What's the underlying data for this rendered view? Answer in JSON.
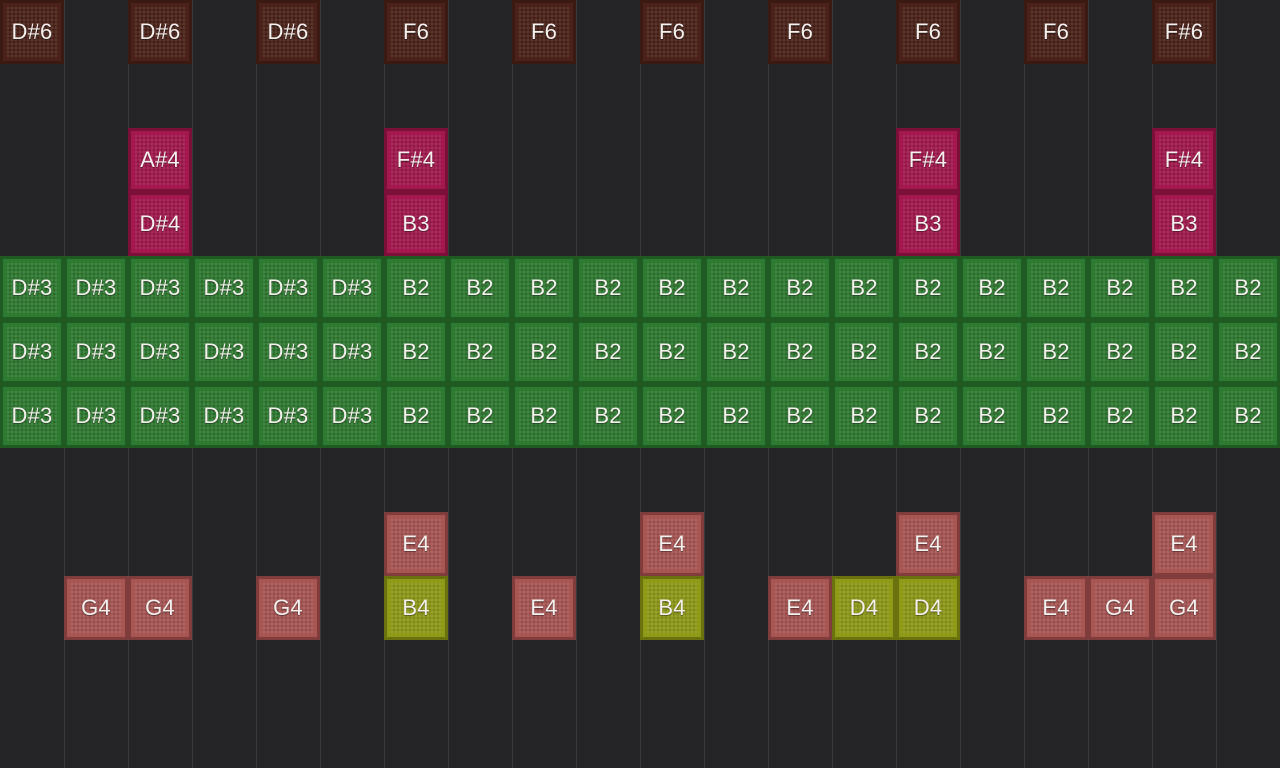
{
  "grid": {
    "columns": 20,
    "rows": 12,
    "background": "#252527",
    "column_line_color": "#39393c"
  },
  "palette": {
    "high": {
      "bg": "#4a2219",
      "border": "#3a1912"
    },
    "magenta": {
      "bg": "#a3184e",
      "border": "#7a0f37"
    },
    "bass": {
      "bg": "#2f7a31",
      "border": "#1f5a22"
    },
    "salmon": {
      "bg": "#a85654",
      "border": "#7e3c3b"
    },
    "olive": {
      "bg": "#8f9a18",
      "border": "#6a720f"
    }
  },
  "notes": [
    {
      "col": 0,
      "row": 0,
      "label": "D#6",
      "color": "high"
    },
    {
      "col": 2,
      "row": 0,
      "label": "D#6",
      "color": "high"
    },
    {
      "col": 4,
      "row": 0,
      "label": "D#6",
      "color": "high"
    },
    {
      "col": 6,
      "row": 0,
      "label": "F6",
      "color": "high"
    },
    {
      "col": 8,
      "row": 0,
      "label": "F6",
      "color": "high"
    },
    {
      "col": 10,
      "row": 0,
      "label": "F6",
      "color": "high"
    },
    {
      "col": 12,
      "row": 0,
      "label": "F6",
      "color": "high"
    },
    {
      "col": 14,
      "row": 0,
      "label": "F6",
      "color": "high"
    },
    {
      "col": 16,
      "row": 0,
      "label": "F6",
      "color": "high"
    },
    {
      "col": 18,
      "row": 0,
      "label": "F#6",
      "color": "high"
    },
    {
      "col": 2,
      "row": 2,
      "label": "A#4",
      "color": "magenta"
    },
    {
      "col": 6,
      "row": 2,
      "label": "F#4",
      "color": "magenta"
    },
    {
      "col": 14,
      "row": 2,
      "label": "F#4",
      "color": "magenta"
    },
    {
      "col": 18,
      "row": 2,
      "label": "F#4",
      "color": "magenta"
    },
    {
      "col": 2,
      "row": 3,
      "label": "D#4",
      "color": "magenta"
    },
    {
      "col": 6,
      "row": 3,
      "label": "B3",
      "color": "magenta"
    },
    {
      "col": 14,
      "row": 3,
      "label": "B3",
      "color": "magenta"
    },
    {
      "col": 18,
      "row": 3,
      "label": "B3",
      "color": "magenta"
    },
    {
      "col": 0,
      "row": 4,
      "label": "D#3",
      "color": "bass"
    },
    {
      "col": 1,
      "row": 4,
      "label": "D#3",
      "color": "bass"
    },
    {
      "col": 2,
      "row": 4,
      "label": "D#3",
      "color": "bass"
    },
    {
      "col": 3,
      "row": 4,
      "label": "D#3",
      "color": "bass"
    },
    {
      "col": 4,
      "row": 4,
      "label": "D#3",
      "color": "bass"
    },
    {
      "col": 5,
      "row": 4,
      "label": "D#3",
      "color": "bass"
    },
    {
      "col": 6,
      "row": 4,
      "label": "B2",
      "color": "bass"
    },
    {
      "col": 7,
      "row": 4,
      "label": "B2",
      "color": "bass"
    },
    {
      "col": 8,
      "row": 4,
      "label": "B2",
      "color": "bass"
    },
    {
      "col": 9,
      "row": 4,
      "label": "B2",
      "color": "bass"
    },
    {
      "col": 10,
      "row": 4,
      "label": "B2",
      "color": "bass"
    },
    {
      "col": 11,
      "row": 4,
      "label": "B2",
      "color": "bass"
    },
    {
      "col": 12,
      "row": 4,
      "label": "B2",
      "color": "bass"
    },
    {
      "col": 13,
      "row": 4,
      "label": "B2",
      "color": "bass"
    },
    {
      "col": 14,
      "row": 4,
      "label": "B2",
      "color": "bass"
    },
    {
      "col": 15,
      "row": 4,
      "label": "B2",
      "color": "bass"
    },
    {
      "col": 16,
      "row": 4,
      "label": "B2",
      "color": "bass"
    },
    {
      "col": 17,
      "row": 4,
      "label": "B2",
      "color": "bass"
    },
    {
      "col": 18,
      "row": 4,
      "label": "B2",
      "color": "bass"
    },
    {
      "col": 19,
      "row": 4,
      "label": "B2",
      "color": "bass"
    },
    {
      "col": 0,
      "row": 5,
      "label": "D#3",
      "color": "bass"
    },
    {
      "col": 1,
      "row": 5,
      "label": "D#3",
      "color": "bass"
    },
    {
      "col": 2,
      "row": 5,
      "label": "D#3",
      "color": "bass"
    },
    {
      "col": 3,
      "row": 5,
      "label": "D#3",
      "color": "bass"
    },
    {
      "col": 4,
      "row": 5,
      "label": "D#3",
      "color": "bass"
    },
    {
      "col": 5,
      "row": 5,
      "label": "D#3",
      "color": "bass"
    },
    {
      "col": 6,
      "row": 5,
      "label": "B2",
      "color": "bass"
    },
    {
      "col": 7,
      "row": 5,
      "label": "B2",
      "color": "bass"
    },
    {
      "col": 8,
      "row": 5,
      "label": "B2",
      "color": "bass"
    },
    {
      "col": 9,
      "row": 5,
      "label": "B2",
      "color": "bass"
    },
    {
      "col": 10,
      "row": 5,
      "label": "B2",
      "color": "bass"
    },
    {
      "col": 11,
      "row": 5,
      "label": "B2",
      "color": "bass"
    },
    {
      "col": 12,
      "row": 5,
      "label": "B2",
      "color": "bass"
    },
    {
      "col": 13,
      "row": 5,
      "label": "B2",
      "color": "bass"
    },
    {
      "col": 14,
      "row": 5,
      "label": "B2",
      "color": "bass"
    },
    {
      "col": 15,
      "row": 5,
      "label": "B2",
      "color": "bass"
    },
    {
      "col": 16,
      "row": 5,
      "label": "B2",
      "color": "bass"
    },
    {
      "col": 17,
      "row": 5,
      "label": "B2",
      "color": "bass"
    },
    {
      "col": 18,
      "row": 5,
      "label": "B2",
      "color": "bass"
    },
    {
      "col": 19,
      "row": 5,
      "label": "B2",
      "color": "bass"
    },
    {
      "col": 0,
      "row": 6,
      "label": "D#3",
      "color": "bass"
    },
    {
      "col": 1,
      "row": 6,
      "label": "D#3",
      "color": "bass"
    },
    {
      "col": 2,
      "row": 6,
      "label": "D#3",
      "color": "bass"
    },
    {
      "col": 3,
      "row": 6,
      "label": "D#3",
      "color": "bass"
    },
    {
      "col": 4,
      "row": 6,
      "label": "D#3",
      "color": "bass"
    },
    {
      "col": 5,
      "row": 6,
      "label": "D#3",
      "color": "bass"
    },
    {
      "col": 6,
      "row": 6,
      "label": "B2",
      "color": "bass"
    },
    {
      "col": 7,
      "row": 6,
      "label": "B2",
      "color": "bass"
    },
    {
      "col": 8,
      "row": 6,
      "label": "B2",
      "color": "bass"
    },
    {
      "col": 9,
      "row": 6,
      "label": "B2",
      "color": "bass"
    },
    {
      "col": 10,
      "row": 6,
      "label": "B2",
      "color": "bass"
    },
    {
      "col": 11,
      "row": 6,
      "label": "B2",
      "color": "bass"
    },
    {
      "col": 12,
      "row": 6,
      "label": "B2",
      "color": "bass"
    },
    {
      "col": 13,
      "row": 6,
      "label": "B2",
      "color": "bass"
    },
    {
      "col": 14,
      "row": 6,
      "label": "B2",
      "color": "bass"
    },
    {
      "col": 15,
      "row": 6,
      "label": "B2",
      "color": "bass"
    },
    {
      "col": 16,
      "row": 6,
      "label": "B2",
      "color": "bass"
    },
    {
      "col": 17,
      "row": 6,
      "label": "B2",
      "color": "bass"
    },
    {
      "col": 18,
      "row": 6,
      "label": "B2",
      "color": "bass"
    },
    {
      "col": 19,
      "row": 6,
      "label": "B2",
      "color": "bass"
    },
    {
      "col": 6,
      "row": 8,
      "label": "E4",
      "color": "salmon"
    },
    {
      "col": 10,
      "row": 8,
      "label": "E4",
      "color": "salmon"
    },
    {
      "col": 14,
      "row": 8,
      "label": "E4",
      "color": "salmon"
    },
    {
      "col": 18,
      "row": 8,
      "label": "E4",
      "color": "salmon"
    },
    {
      "col": 1,
      "row": 9,
      "label": "G4",
      "color": "salmon"
    },
    {
      "col": 2,
      "row": 9,
      "label": "G4",
      "color": "salmon"
    },
    {
      "col": 4,
      "row": 9,
      "label": "G4",
      "color": "salmon"
    },
    {
      "col": 6,
      "row": 9,
      "label": "B4",
      "color": "olive"
    },
    {
      "col": 8,
      "row": 9,
      "label": "E4",
      "color": "salmon"
    },
    {
      "col": 10,
      "row": 9,
      "label": "B4",
      "color": "olive"
    },
    {
      "col": 12,
      "row": 9,
      "label": "E4",
      "color": "salmon"
    },
    {
      "col": 13,
      "row": 9,
      "label": "D4",
      "color": "olive"
    },
    {
      "col": 14,
      "row": 9,
      "label": "D4",
      "color": "olive"
    },
    {
      "col": 16,
      "row": 9,
      "label": "E4",
      "color": "salmon"
    },
    {
      "col": 17,
      "row": 9,
      "label": "G4",
      "color": "salmon"
    },
    {
      "col": 18,
      "row": 9,
      "label": "G4",
      "color": "salmon"
    }
  ]
}
